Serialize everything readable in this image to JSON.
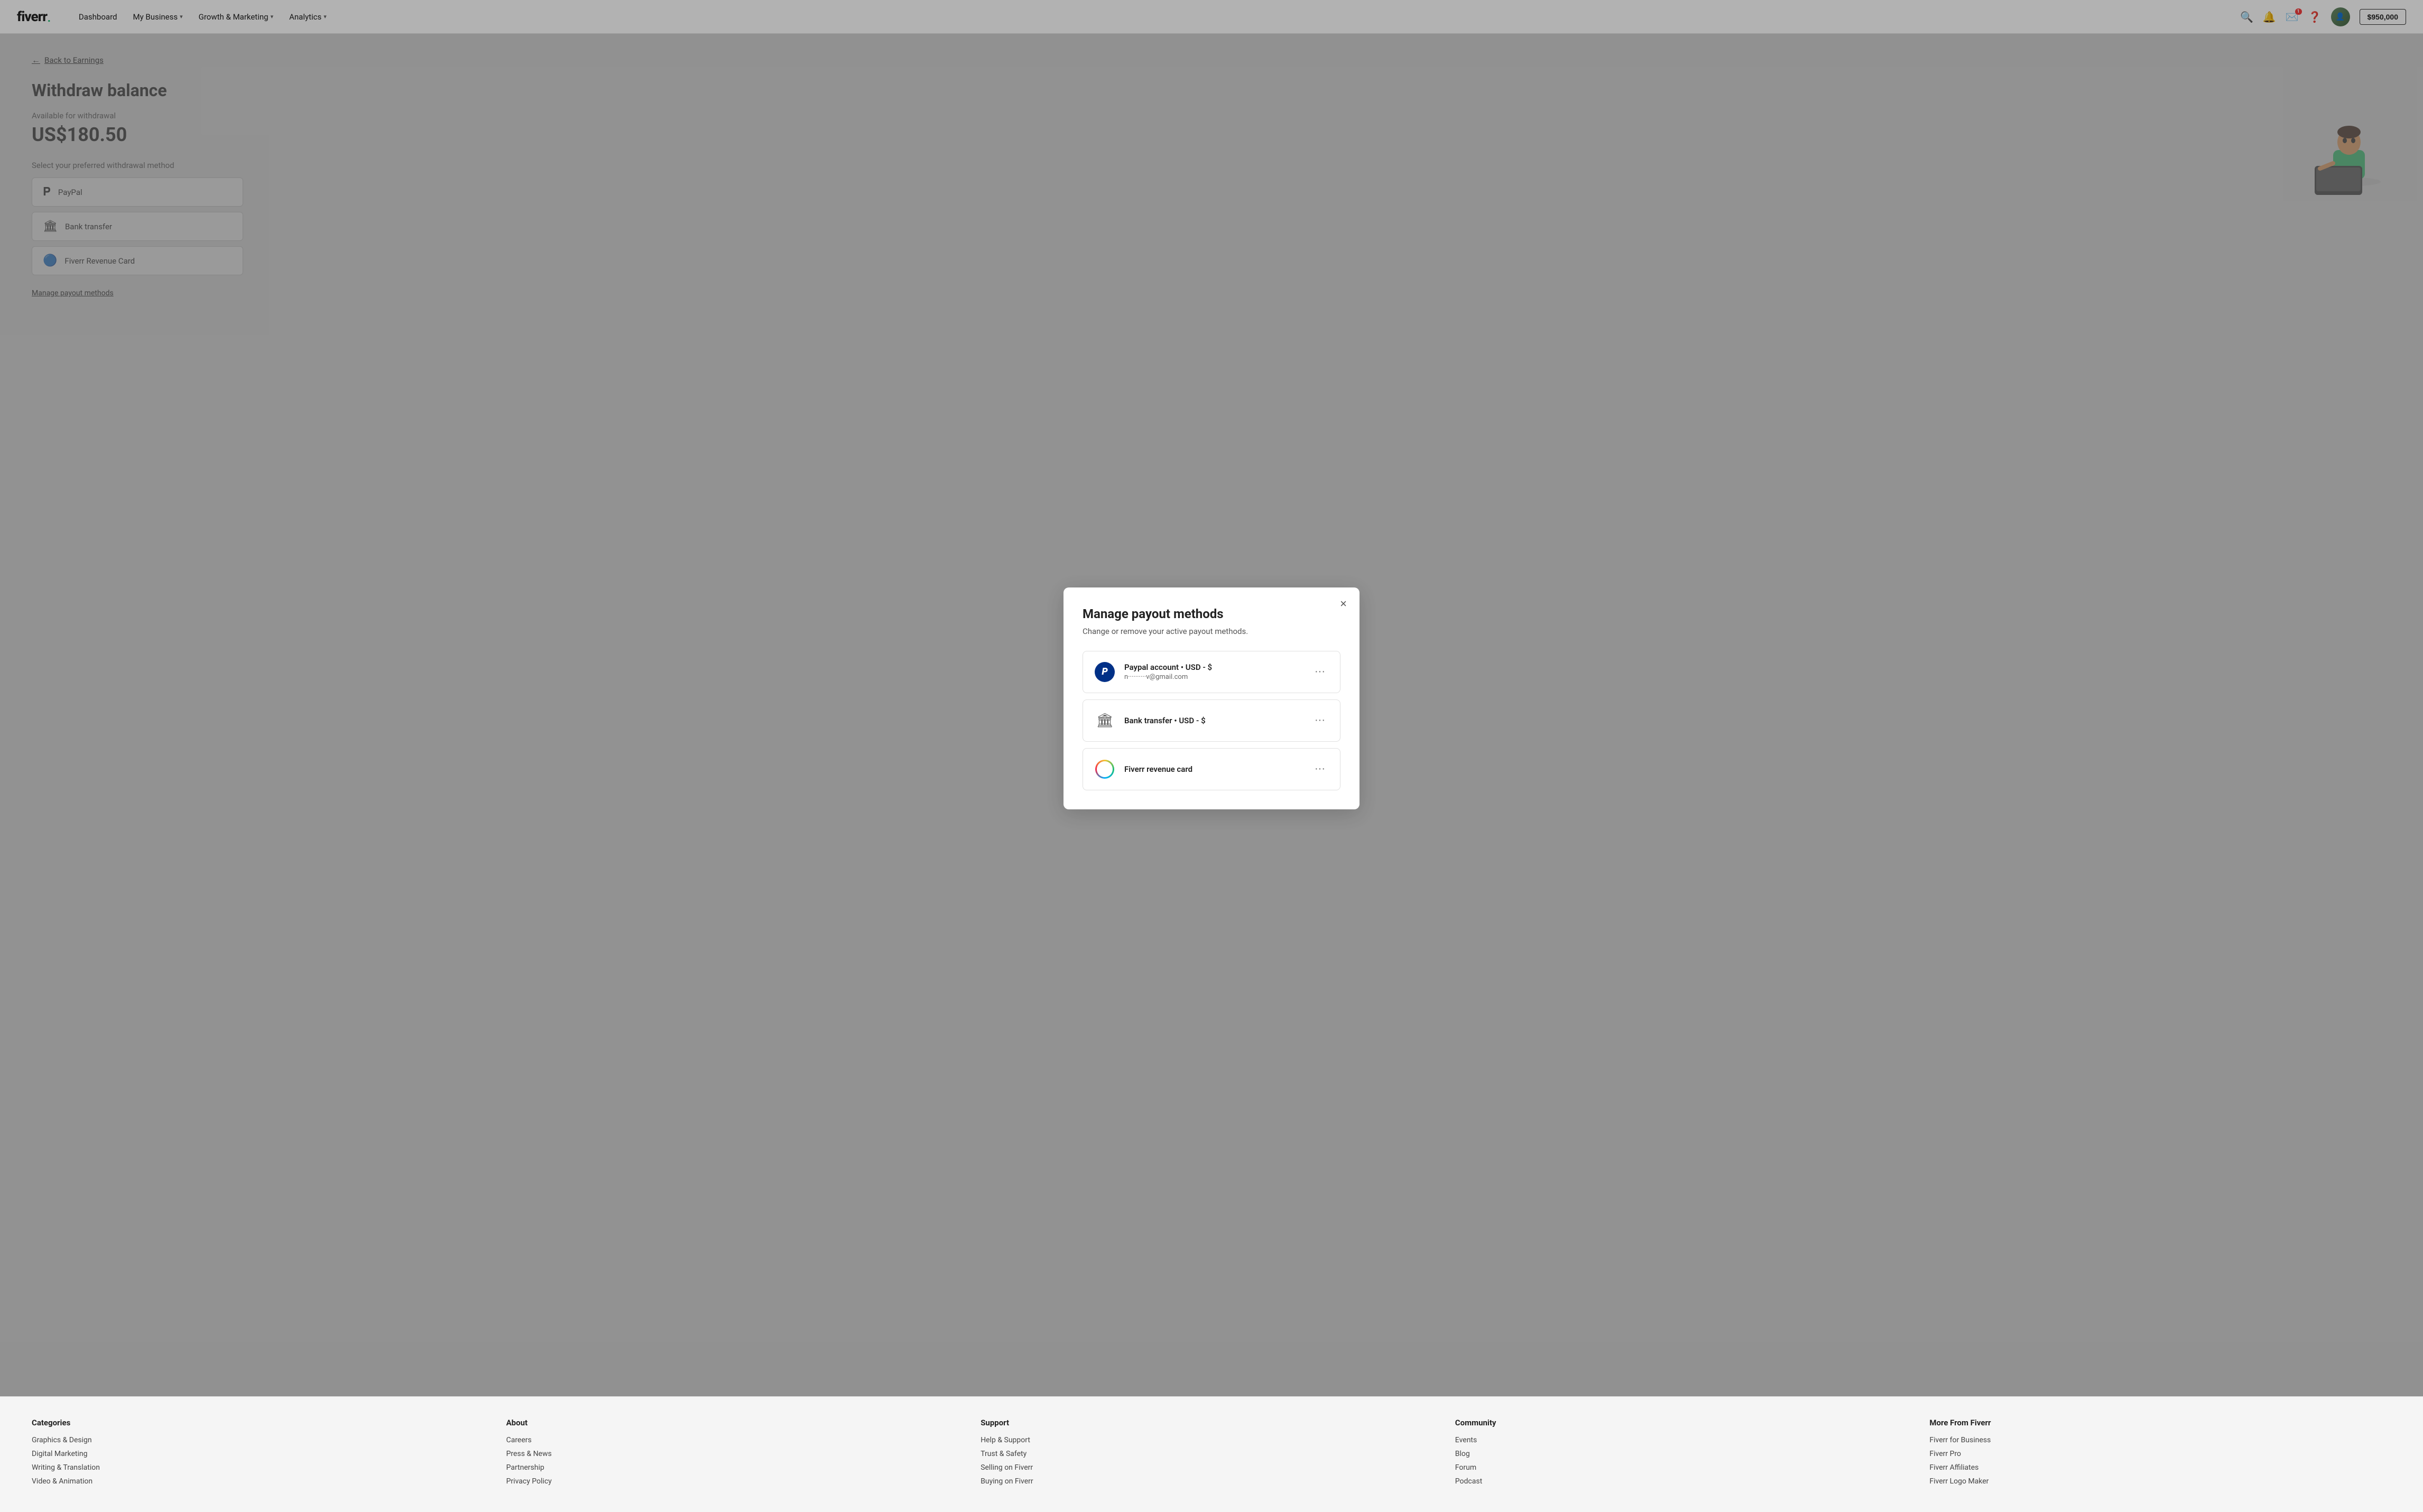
{
  "navbar": {
    "logo": "fiverr",
    "logo_dot": ".",
    "nav_items": [
      {
        "label": "Dashboard"
      },
      {
        "label": "My Business",
        "has_dropdown": true
      },
      {
        "label": "Growth & Marketing",
        "has_dropdown": true
      },
      {
        "label": "Analytics",
        "has_dropdown": true
      }
    ],
    "balance": "$950,000"
  },
  "page": {
    "back_link": "Back to Earnings",
    "title": "Withdraw balance",
    "available_label": "Available for withdrawal",
    "balance_amount": "US$180.50",
    "select_label": "Select your preferred withdrawal method",
    "payout_options": [
      {
        "icon": "paypal",
        "label": "PayPal"
      },
      {
        "icon": "bank",
        "label": "Bank transfer"
      },
      {
        "icon": "fiverr",
        "label": "Fiverr Revenue Card"
      }
    ],
    "manage_link": "Manage payout methods"
  },
  "modal": {
    "title": "Manage payout methods",
    "subtitle": "Change or remove your active payout methods.",
    "methods": [
      {
        "type": "paypal",
        "name": "Paypal account • USD - $",
        "email": "n··········v@gmail.com"
      },
      {
        "type": "bank",
        "name": "Bank transfer • USD - $",
        "email": ""
      },
      {
        "type": "fiverr",
        "name": "Fiverr revenue card",
        "email": ""
      }
    ],
    "close_label": "×"
  },
  "footer": {
    "columns": [
      {
        "title": "Categories",
        "links": [
          "Graphics & Design",
          "Digital Marketing",
          "Writing & Translation",
          "Video & Animation"
        ]
      },
      {
        "title": "About",
        "links": [
          "Careers",
          "Press & News",
          "Partnership",
          "Privacy Policy"
        ]
      },
      {
        "title": "Support",
        "links": [
          "Help & Support",
          "Trust & Safety",
          "Selling on Fiverr",
          "Buying on Fiverr"
        ]
      },
      {
        "title": "Community",
        "links": [
          "Events",
          "Blog",
          "Forum",
          "Podcast"
        ]
      },
      {
        "title": "More From Fiverr",
        "links": [
          "Fiverr for Business",
          "Fiverr Pro",
          "Fiverr Affiliates",
          "Fiverr Logo Maker"
        ]
      }
    ]
  }
}
